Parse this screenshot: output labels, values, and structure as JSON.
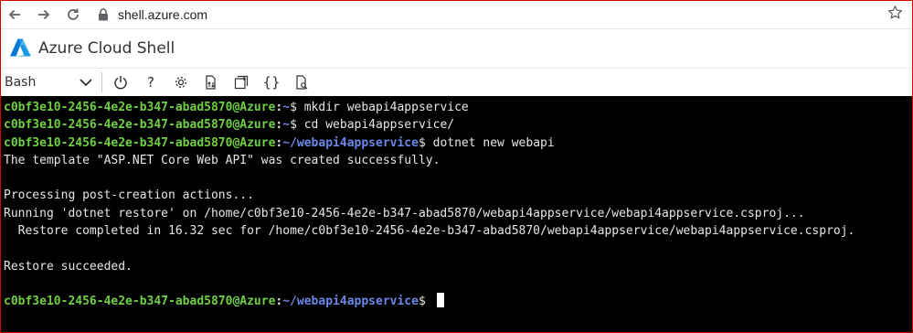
{
  "browser": {
    "url": "shell.azure.com",
    "icons": [
      "back-arrow-icon",
      "forward-arrow-icon",
      "reload-icon",
      "lock-icon",
      "star-icon"
    ]
  },
  "app": {
    "title": "Azure Cloud Shell",
    "logo": "azure-logo"
  },
  "toolbar": {
    "shell_type": "Bash",
    "icons": [
      "power-icon",
      "help-icon",
      "settings-icon",
      "upload-download-icon",
      "new-session-icon",
      "editor-braces-icon",
      "web-preview-icon"
    ],
    "help_glyph": "?",
    "braces_glyph": "{}"
  },
  "terminal": {
    "colors": {
      "user": "#6ed042",
      "path": "#6b87e8",
      "text": "#e6e6e6",
      "background": "#000000"
    },
    "prompt_user": "c0bf3e10-2456-4e2e-b347-abad5870@Azure",
    "lines": [
      {
        "path": ":~",
        "cmd": "$ mkdir webapi4appservice"
      },
      {
        "path": ":~",
        "cmd": "$ cd webapi4appservice/"
      },
      {
        "path": ":~/webapi4appservice",
        "cmd": "$ dotnet new webapi"
      },
      {
        "text": "The template \"ASP.NET Core Web API\" was created successfully."
      },
      {
        "text": ""
      },
      {
        "text": "Processing post-creation actions..."
      },
      {
        "text": "Running 'dotnet restore' on /home/c0bf3e10-2456-4e2e-b347-abad5870/webapi4appservice/webapi4appservice.csproj..."
      },
      {
        "text": "  Restore completed in 16.32 sec for /home/c0bf3e10-2456-4e2e-b347-abad5870/webapi4appservice/webapi4appservice.csproj."
      },
      {
        "text": ""
      },
      {
        "text": "Restore succeeded."
      },
      {
        "text": ""
      },
      {
        "path": ":~/webapi4appservice",
        "cmd": "$ "
      }
    ]
  }
}
